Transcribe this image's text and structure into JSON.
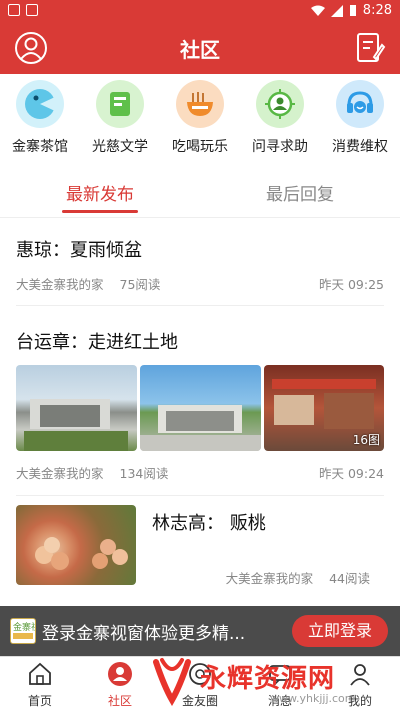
{
  "status_bar": {
    "time": "8:28"
  },
  "header": {
    "title": "社区"
  },
  "categories": [
    {
      "label": "金寨茶馆",
      "icon": "tea-house-icon",
      "color": "#7ad6ee"
    },
    {
      "label": "光慈文学",
      "icon": "book-icon",
      "color": "#8fdc7a"
    },
    {
      "label": "吃喝玩乐",
      "icon": "noodle-bowl-icon",
      "color": "#f5a04e"
    },
    {
      "label": "问寻求助",
      "icon": "help-person-icon",
      "color": "#7fd36a"
    },
    {
      "label": "消费维权",
      "icon": "headset-icon",
      "color": "#5bb8f2"
    }
  ],
  "tabs": [
    {
      "label": "最新发布",
      "active": true
    },
    {
      "label": "最后回复",
      "active": false
    }
  ],
  "posts": [
    {
      "title": "惠琼：夏雨倾盆",
      "source": "大美金寨我的家",
      "reads": "75阅读",
      "time": "昨天 09:25"
    },
    {
      "title": "台运章：走进红土地",
      "source": "大美金寨我的家",
      "reads": "134阅读",
      "time": "昨天 09:24",
      "image_count": "16图"
    },
    {
      "title": "林志高： 贩桃",
      "source": "大美金寨我的家",
      "reads": "44阅读"
    }
  ],
  "banner": {
    "text": "登录金寨视窗体验更多精...",
    "button": "立即登录",
    "logo_text": "金寨视窗"
  },
  "bottom_nav": [
    {
      "label": "首页",
      "icon": "home-icon",
      "active": false
    },
    {
      "label": "社区",
      "icon": "community-icon",
      "active": true
    },
    {
      "label": "金友圈",
      "icon": "friends-circle-icon",
      "active": false
    },
    {
      "label": "消息",
      "icon": "message-icon",
      "active": false
    },
    {
      "label": "我的",
      "icon": "profile-icon",
      "active": false
    }
  ],
  "watermark": {
    "text": "永辉资源网",
    "url": "www.yhkjjj.com"
  },
  "colors": {
    "brand": "#d93a36",
    "text_muted": "#888888"
  }
}
